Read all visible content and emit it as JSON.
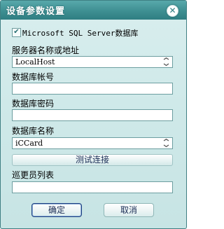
{
  "window": {
    "title": "设备参数设置"
  },
  "checkbox": {
    "label": "Microsoft SQL Server数据库",
    "checked": true
  },
  "server": {
    "label": "服务器名称或地址",
    "value": "LocalHost"
  },
  "account": {
    "label": "数据库帐号",
    "value": ""
  },
  "password": {
    "label": "数据库密码",
    "value": ""
  },
  "database": {
    "label": "数据库名称",
    "value": "iCCard"
  },
  "test_button": {
    "label": "测试连接"
  },
  "patrol": {
    "label": "巡更员列表",
    "value": ""
  },
  "buttons": {
    "ok": "确定",
    "cancel": "取消"
  },
  "colors": {
    "title_bar": "#3e8f92",
    "window_bg": "#cfe9e9",
    "border": "#6c9ea0"
  },
  "icons": {
    "close": "close-icon",
    "check": "check-icon",
    "dropdown": "chevron-down-icon"
  }
}
